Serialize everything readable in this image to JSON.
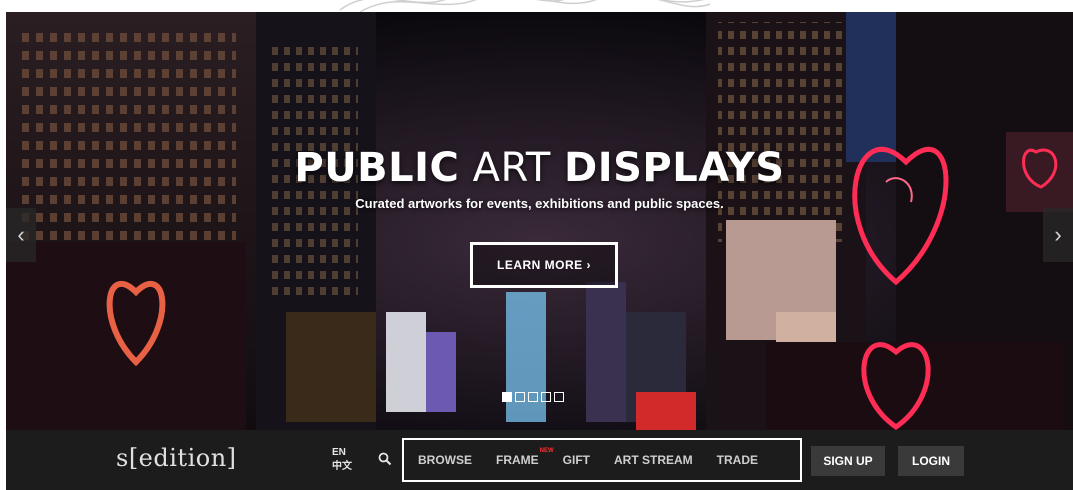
{
  "hero": {
    "title_bold_1": "PUBLIC",
    "title_light": "ART",
    "title_bold_2": "DISPLAYS",
    "subtitle": "Curated artworks for events, exhibitions and public spaces.",
    "cta_label": "LEARN MORE ›",
    "prev_arrow": "‹",
    "next_arrow": "›",
    "slides": 5,
    "active_slide": 1
  },
  "navbar": {
    "logo": "s[edition]",
    "lang_primary": "EN",
    "lang_secondary": "中文",
    "menu": [
      {
        "label": "BROWSE"
      },
      {
        "label": "FRAME",
        "badge": "NEW"
      },
      {
        "label": "GIFT"
      },
      {
        "label": "ART STREAM"
      },
      {
        "label": "TRADE"
      }
    ],
    "signup_label": "SIGN UP",
    "login_label": "LOGIN"
  },
  "colors": {
    "navbar_bg": "#1c1c1c",
    "button_bg": "#3a3a3a",
    "neon_red": "#ff2d55",
    "new_badge": "#ff2d2d"
  },
  "icons": [
    "search-icon",
    "chevron-left-icon",
    "chevron-right-icon"
  ]
}
